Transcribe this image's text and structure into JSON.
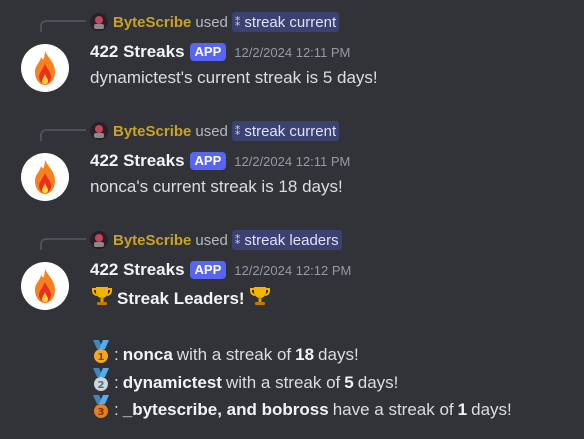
{
  "messages": [
    {
      "reply": {
        "user": "ByteScribe",
        "used": "used",
        "command": "streak current"
      },
      "author": "422 Streaks",
      "badge": "APP",
      "timestamp": "12/2/2024 12:11 PM",
      "text": "dynamictest's current streak is 5 days!"
    },
    {
      "reply": {
        "user": "ByteScribe",
        "used": "used",
        "command": "streak current"
      },
      "author": "422 Streaks",
      "badge": "APP",
      "timestamp": "12/2/2024 12:11 PM",
      "text": "nonca's current streak is 18 days!"
    },
    {
      "reply": {
        "user": "ByteScribe",
        "used": "used",
        "command": "streak leaders"
      },
      "author": "422 Streaks",
      "badge": "APP",
      "timestamp": "12/2/2024 12:12 PM",
      "title": "Streak Leaders!",
      "leaders": [
        {
          "sep": ":",
          "name": "nonca",
          "mid": "with a streak of",
          "count": "18",
          "tail": "days!"
        },
        {
          "sep": ":",
          "name": "dynamictest",
          "mid": "with a streak of",
          "count": "5",
          "tail": "days!"
        },
        {
          "sep": ":",
          "name": "_bytescribe, and bobross",
          "mid": "have a streak of",
          "count": "1",
          "tail": "days!"
        }
      ]
    }
  ],
  "colors": {
    "background": "#313338",
    "reply_user": "#c9a227",
    "command_bg": "#3c4270",
    "app_badge": "#5865f2"
  },
  "icons": [
    "bot-avatar-fire-icon",
    "user-mini-avatar-icon",
    "slash-command-icon",
    "trophy-icon",
    "first-place-medal-icon",
    "second-place-medal-icon",
    "third-place-medal-icon"
  ]
}
